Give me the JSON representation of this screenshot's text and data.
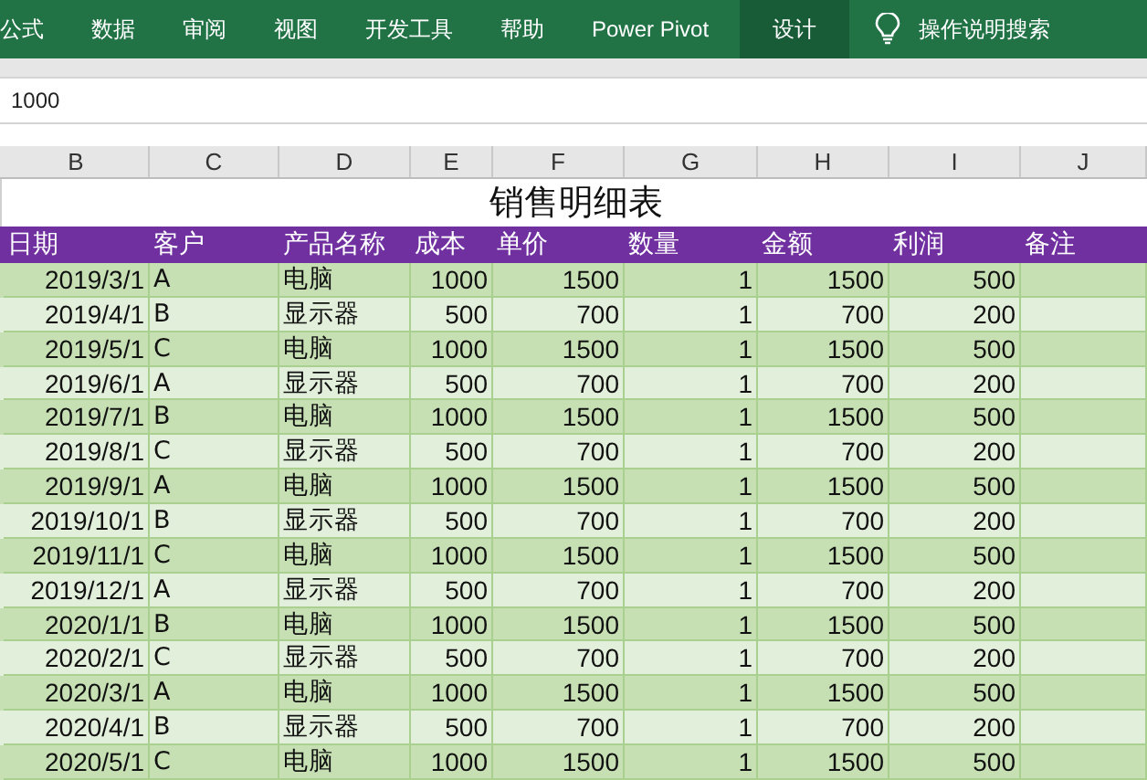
{
  "ribbon_tabs": [
    {
      "label": "公式",
      "selected": false
    },
    {
      "label": "数据",
      "selected": false
    },
    {
      "label": "审阅",
      "selected": false
    },
    {
      "label": "视图",
      "selected": false
    },
    {
      "label": "开发工具",
      "selected": false
    },
    {
      "label": "帮助",
      "selected": false
    },
    {
      "label": "Power Pivot",
      "selected": false
    },
    {
      "label": "设计",
      "selected": true
    }
  ],
  "tell_me": {
    "placeholder": "操作说明搜索"
  },
  "formula_bar": {
    "value": "1000"
  },
  "column_letters": [
    "B",
    "C",
    "D",
    "E",
    "F",
    "G",
    "H",
    "I",
    "J"
  ],
  "sheet_title": "销售明细表",
  "table": {
    "columns": [
      "日期",
      "客户",
      "产品名称",
      "成本",
      "单价",
      "数量",
      "金额",
      "利润",
      "备注"
    ],
    "rows": [
      [
        "2019/3/1",
        "A",
        "电脑",
        "1000",
        "1500",
        "1",
        "1500",
        "500"
      ],
      [
        "2019/4/1",
        "B",
        "显示器",
        "500",
        "700",
        "1",
        "700",
        "200"
      ],
      [
        "2019/5/1",
        "C",
        "电脑",
        "1000",
        "1500",
        "1",
        "1500",
        "500"
      ],
      [
        "2019/6/1",
        "A",
        "显示器",
        "500",
        "700",
        "1",
        "700",
        "200"
      ],
      [
        "2019/7/1",
        "B",
        "电脑",
        "1000",
        "1500",
        "1",
        "1500",
        "500"
      ],
      [
        "2019/8/1",
        "C",
        "显示器",
        "500",
        "700",
        "1",
        "700",
        "200"
      ],
      [
        "2019/9/1",
        "A",
        "电脑",
        "1000",
        "1500",
        "1",
        "1500",
        "500"
      ],
      [
        "2019/10/1",
        "B",
        "显示器",
        "500",
        "700",
        "1",
        "700",
        "200"
      ],
      [
        "2019/11/1",
        "C",
        "电脑",
        "1000",
        "1500",
        "1",
        "1500",
        "500"
      ],
      [
        "2019/12/1",
        "A",
        "显示器",
        "500",
        "700",
        "1",
        "700",
        "200"
      ],
      [
        "2020/1/1",
        "B",
        "电脑",
        "1000",
        "1500",
        "1",
        "1500",
        "500"
      ],
      [
        "2020/2/1",
        "C",
        "显示器",
        "500",
        "700",
        "1",
        "700",
        "200"
      ],
      [
        "2020/3/1",
        "A",
        "电脑",
        "1000",
        "1500",
        "1",
        "1500",
        "500"
      ],
      [
        "2020/4/1",
        "B",
        "显示器",
        "500",
        "700",
        "1",
        "700",
        "200"
      ],
      [
        "2020/5/1",
        "C",
        "电脑",
        "1000",
        "1500",
        "1",
        "1500",
        "500"
      ]
    ]
  }
}
